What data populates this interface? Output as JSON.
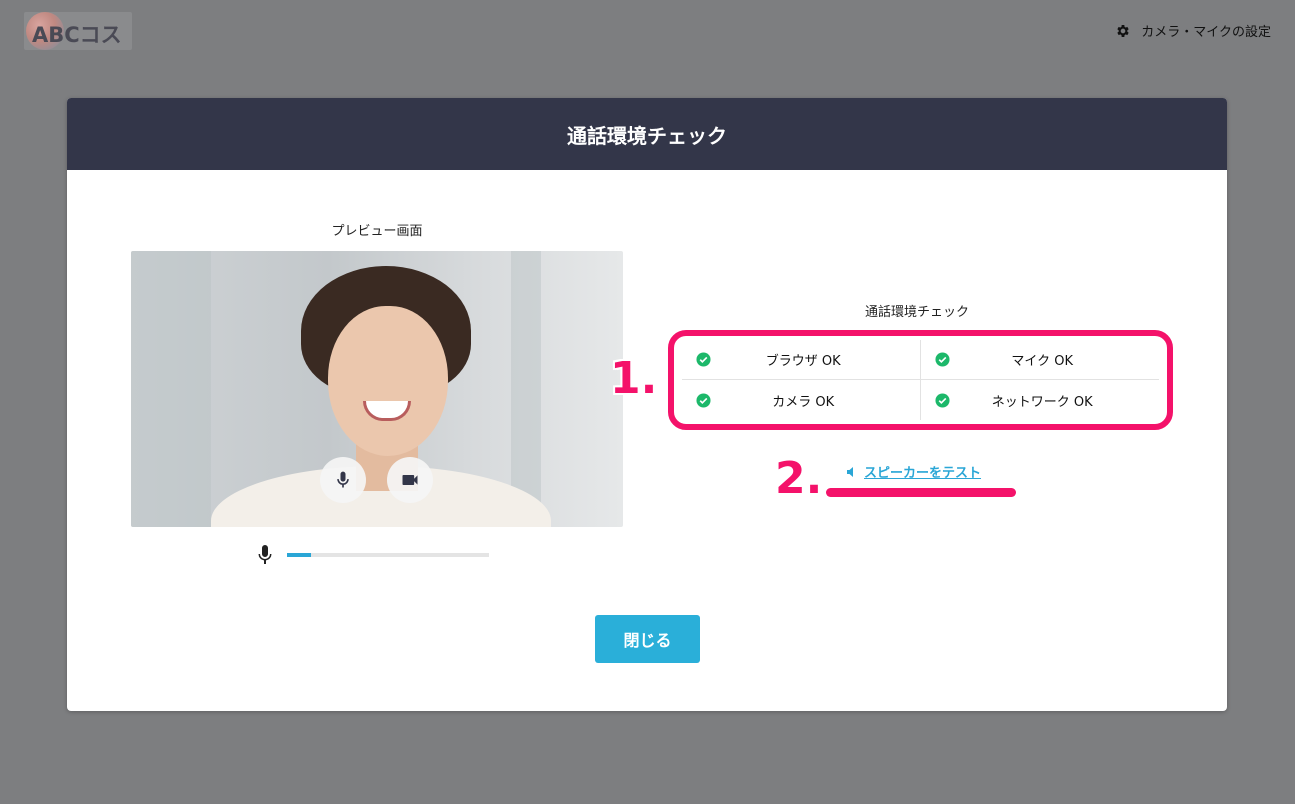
{
  "header": {
    "logo_text": "ABCコスメ",
    "settings_label": "カメラ・マイクの設定"
  },
  "modal": {
    "title": "通話環境チェック",
    "preview_label": "プレビュー画面",
    "mic_level_percent": 12,
    "check_title": "通話環境チェック",
    "checks": [
      {
        "label": "ブラウザ OK",
        "status": "ok"
      },
      {
        "label": "マイク OK",
        "status": "ok"
      },
      {
        "label": "カメラ OK",
        "status": "ok"
      },
      {
        "label": "ネットワーク OK",
        "status": "ok"
      }
    ],
    "speaker_test_label": "スピーカーをテスト",
    "close_label": "閉じる"
  },
  "annotations": {
    "marker_1": "1.",
    "marker_2": "2."
  },
  "colors": {
    "header_bg": "#333649",
    "accent": "#2aafd9",
    "highlight": "#f4126a",
    "ok_green": "#1cb86a"
  }
}
